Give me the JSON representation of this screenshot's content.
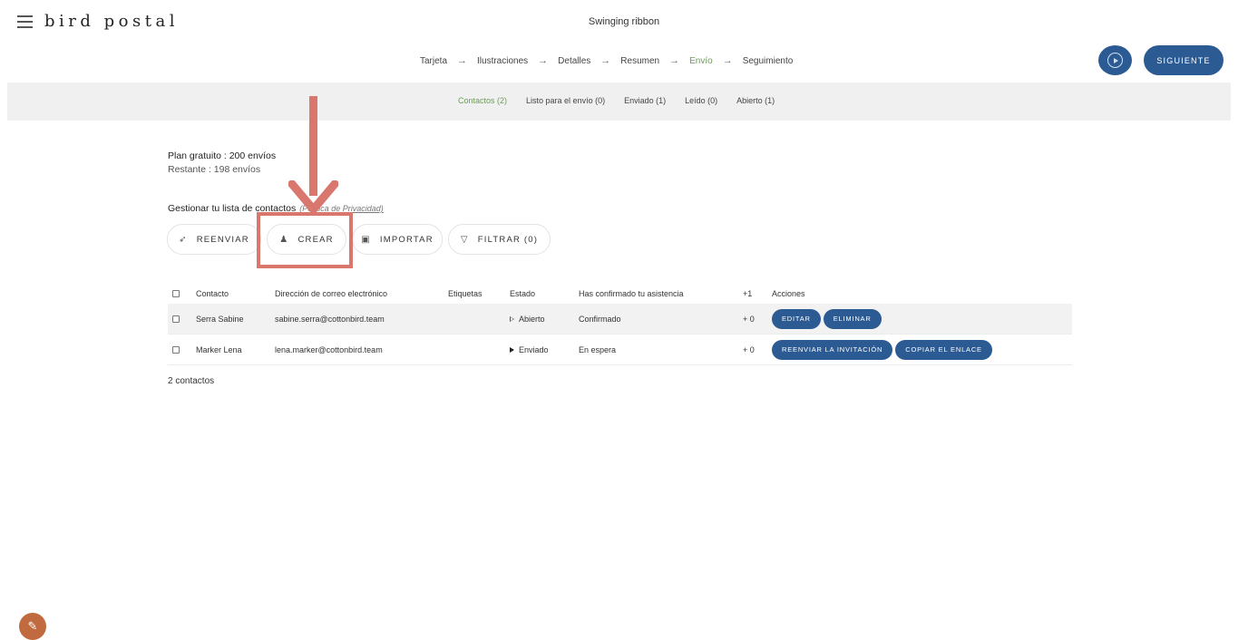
{
  "app": {
    "logo": "bird postal",
    "card_title": "Swinging ribbon"
  },
  "steps": [
    "Tarjeta",
    "Ilustraciones",
    "Detalles",
    "Resumen",
    "Envío",
    "Seguimiento"
  ],
  "active_step": "Envío",
  "header_buttons": {
    "play_icon": "play-circle-icon",
    "next_label": "SIGUIENTE"
  },
  "subtabs": [
    "Contactos (2)",
    "Listo para el envío (0)",
    "Enviado (1)",
    "Leído (0)",
    "Abierto (1)"
  ],
  "plan": {
    "line1": "Plan gratuito : 200 envíos",
    "line2": "Restante : 198 envíos"
  },
  "manage": {
    "title": "Gestionar tu lista de contactos",
    "privacy": "(Política de Privacidad)"
  },
  "actions": {
    "resend": "REENVIAR",
    "create": "CREAR",
    "import": "IMPORTAR",
    "filter": "FILTRAR (0)"
  },
  "table": {
    "headers": {
      "contact": "Contacto",
      "email": "Dirección de correo electrónico",
      "tags": "Etiquetas",
      "status": "Estado",
      "confirmed": "Has confirmado tu asistencia",
      "plus": "+1",
      "actions": "Acciones"
    },
    "rows": [
      {
        "contact": "Serra Sabine",
        "email": "sabine.serra@cottonbird.team",
        "tags": "",
        "status": "Abierto",
        "confirmed": "Confirmado",
        "plus": "+ 0",
        "btn1": "EDITAR",
        "btn2": "ELIMINAR"
      },
      {
        "contact": "Marker Lena",
        "email": "lena.marker@cottonbird.team",
        "tags": "",
        "status": "Enviado",
        "confirmed": "En espera",
        "plus": "+ 0",
        "btn1": "REENVIAR LA INVITACIÓN",
        "btn2": "COPIAR EL ENLACE"
      }
    ]
  },
  "count": "2 contactos",
  "colors": {
    "primary": "#2c5b94",
    "active": "#6f9a5b",
    "annotation": "#d9766e",
    "badge": "#c26a3f"
  }
}
